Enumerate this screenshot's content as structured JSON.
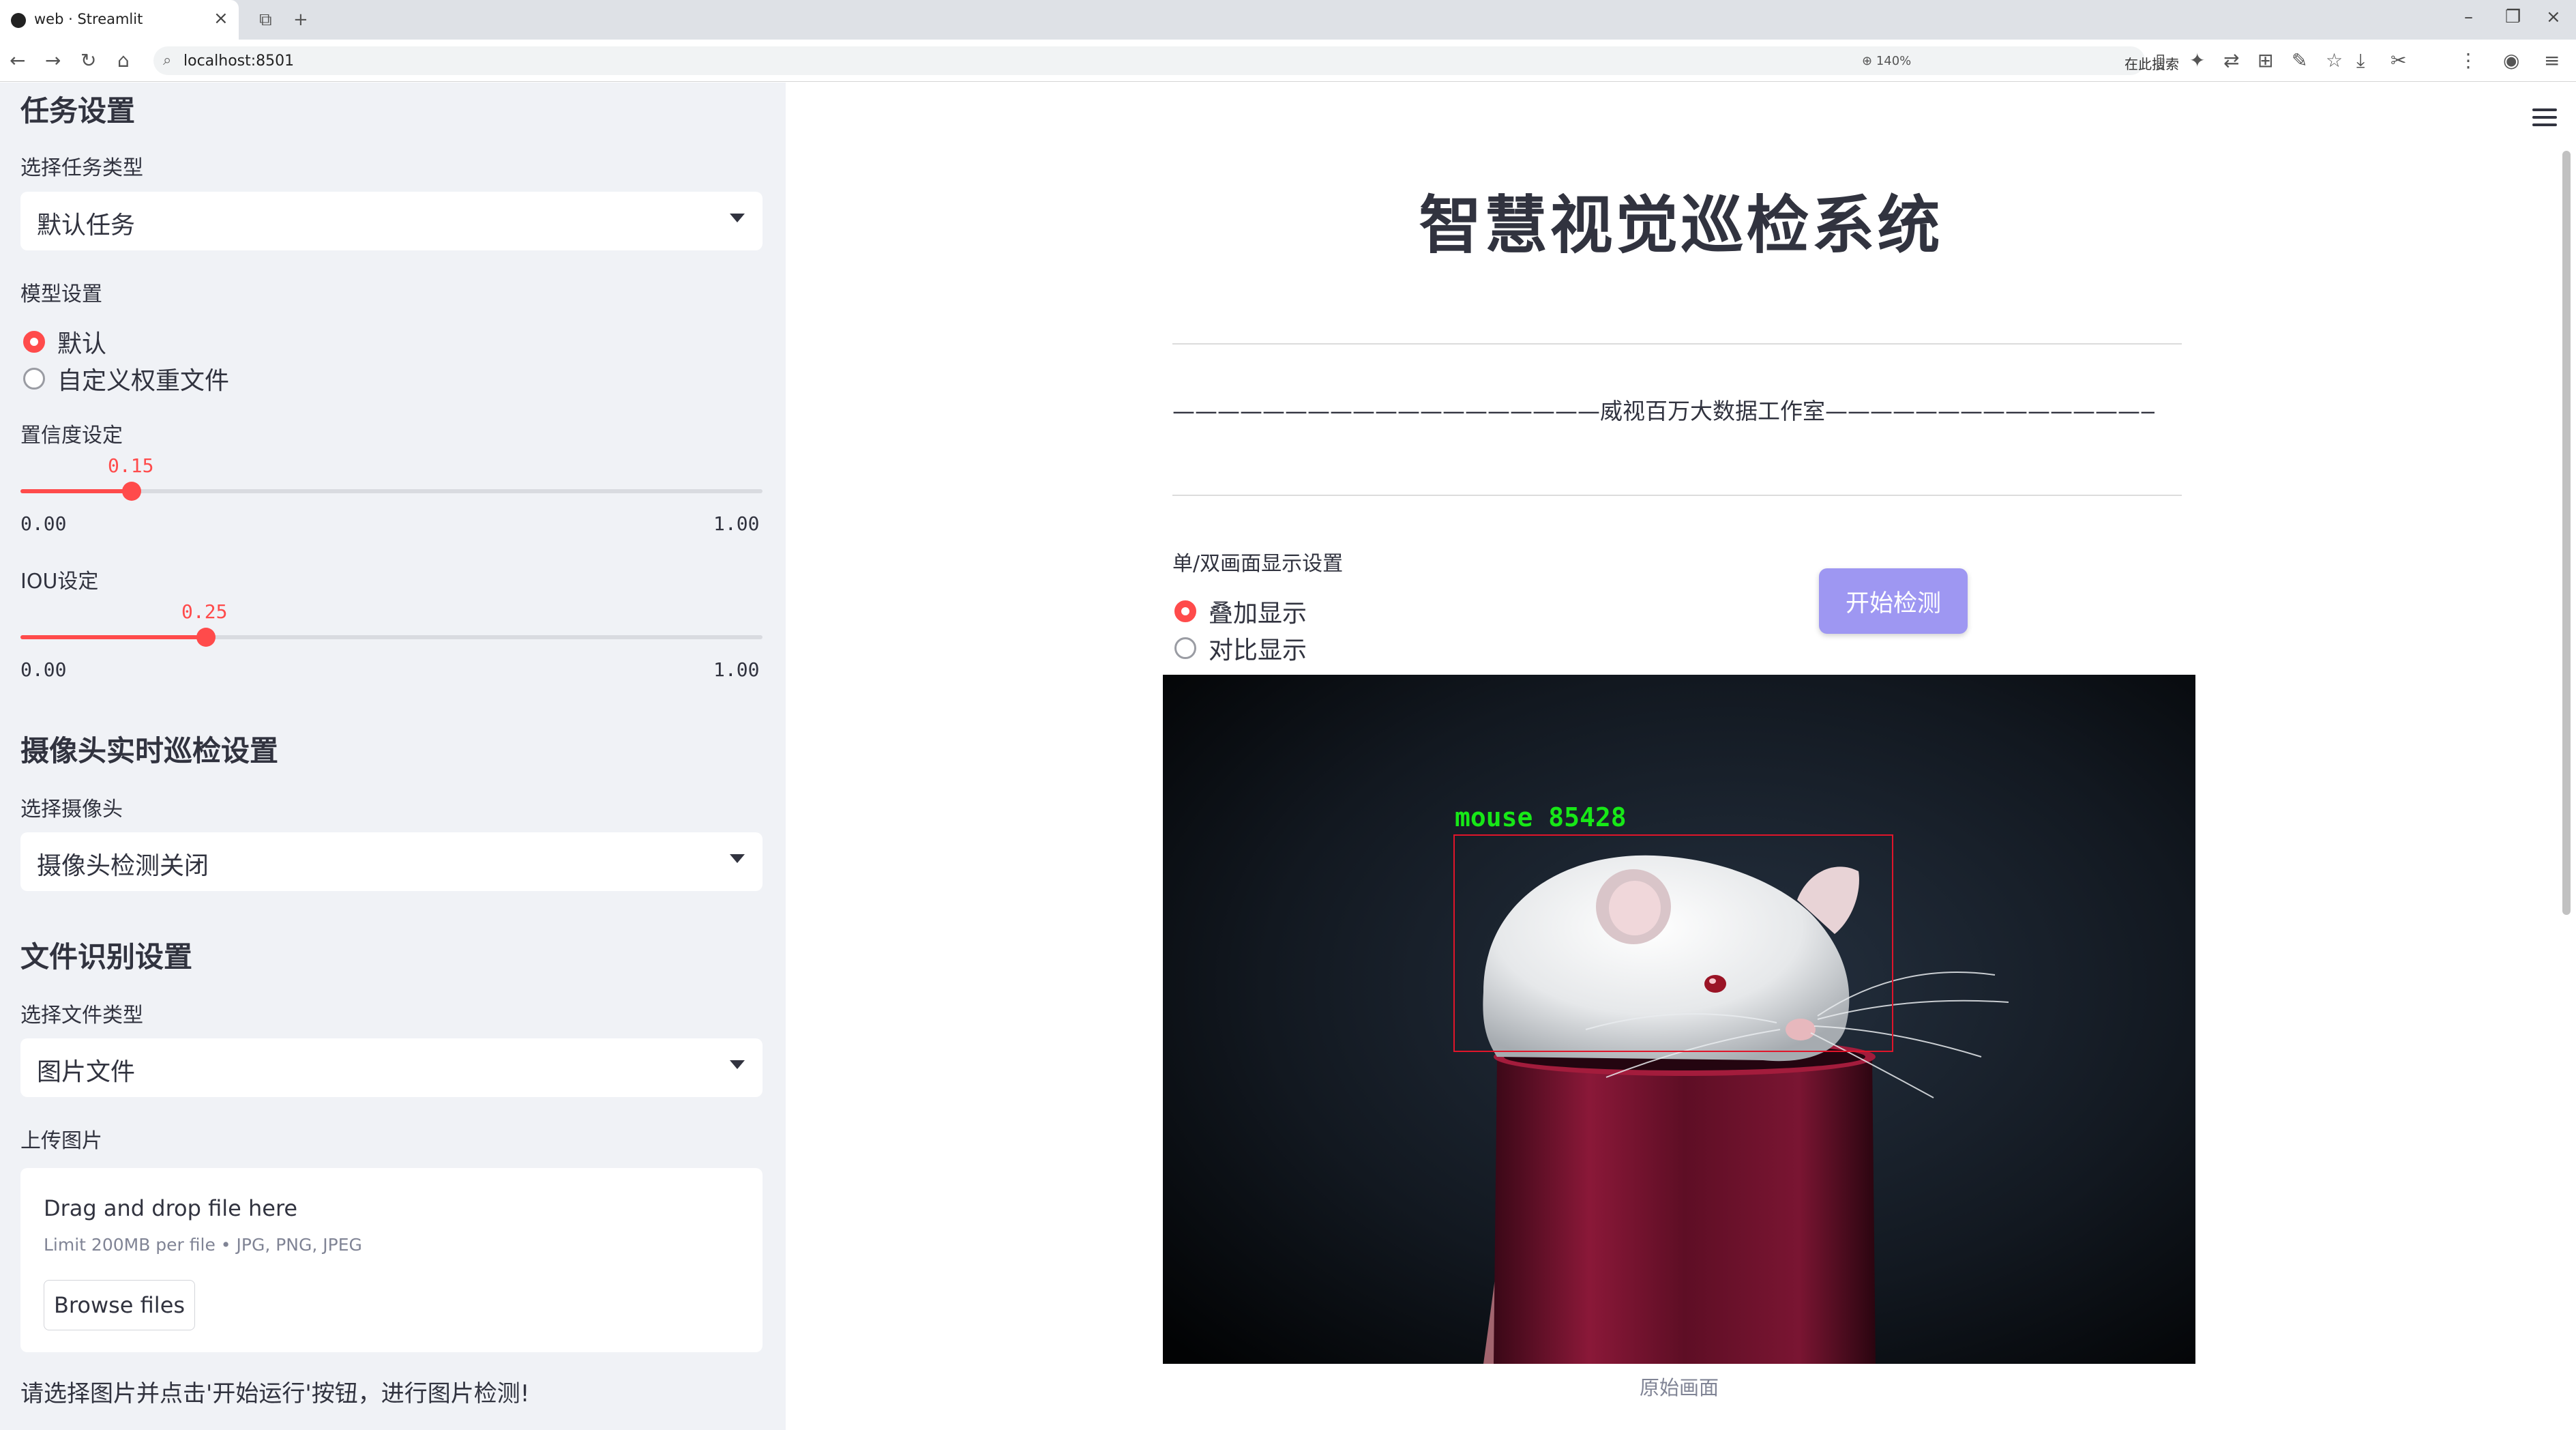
{
  "browser": {
    "tab_title": "web · Streamlit",
    "url": "localhost:8501",
    "zoom": "140%",
    "search_placeholder": "在此搜索"
  },
  "sidebar": {
    "task_section": {
      "title": "任务设置",
      "select_label": "选择任务类型",
      "select_value": "默认任务"
    },
    "model_section": {
      "label": "模型设置",
      "options": [
        "默认",
        "自定义权重文件"
      ],
      "selected": 0
    },
    "confidence": {
      "label": "置信度设定",
      "value": "0.15",
      "min": "0.00",
      "max": "1.00",
      "fraction": 0.15
    },
    "iou": {
      "label": "IOU设定",
      "value": "0.25",
      "min": "0.00",
      "max": "1.00",
      "fraction": 0.25
    },
    "camera_section": {
      "title": "摄像头实时巡检设置",
      "select_label": "选择摄像头",
      "select_value": "摄像头检测关闭"
    },
    "file_section": {
      "title": "文件识别设置",
      "type_label": "选择文件类型",
      "type_value": "图片文件",
      "upload_label": "上传图片",
      "drop_text": "Drag and drop file here",
      "limit_text": "Limit 200MB per file • JPG, PNG, JPEG",
      "browse_label": "Browse files"
    },
    "hint": "请选择图片并点击'开始运行'按钮，进行图片检测!"
  },
  "main": {
    "title": "智慧视觉巡检系统",
    "subtitle": "———————————————————威视百万大数据工作室———————————————————",
    "display_label": "单/双画面显示设置",
    "display_options": [
      "叠加显示",
      "对比显示"
    ],
    "display_selected": 0,
    "run_button": "开始检测",
    "detection_label": "mouse 85428",
    "caption": "原始画面"
  },
  "colors": {
    "accent": "#ff4b4b",
    "button": "#9e97f2",
    "detection_box": "#e0152a",
    "detection_text": "#17e817"
  }
}
